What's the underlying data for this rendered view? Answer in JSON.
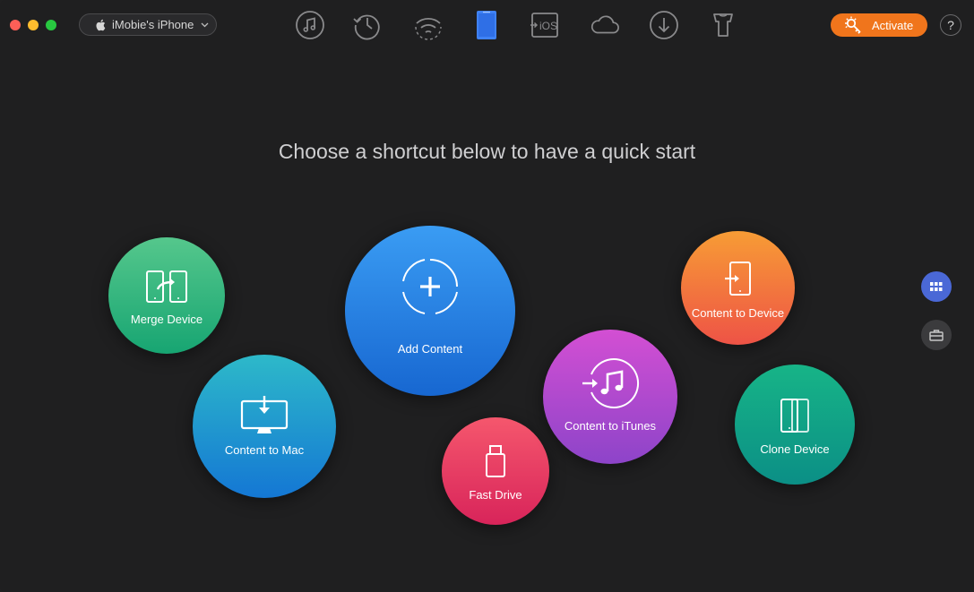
{
  "window": {
    "device_selector": {
      "label": "iMobie's iPhone",
      "icon": "apple-icon"
    }
  },
  "toolbar": {
    "tools": [
      {
        "name": "music-icon"
      },
      {
        "name": "history-icon"
      },
      {
        "name": "wifi-sync-icon"
      },
      {
        "name": "device-manager-icon"
      },
      {
        "name": "ios-mover-icon",
        "text": "iOS"
      },
      {
        "name": "icloud-icon"
      },
      {
        "name": "download-icon"
      },
      {
        "name": "ringtone-icon"
      }
    ],
    "active_tool": "device-manager-icon",
    "activate_label": "Activate",
    "help_label": "?"
  },
  "main": {
    "headline": "Choose a shortcut below to have a quick start",
    "shortcuts": [
      {
        "id": "merge-device",
        "label": "Merge Device",
        "color_top": "#55c78c",
        "color_bottom": "#17a572"
      },
      {
        "id": "content-to-mac",
        "label": "Content to Mac",
        "color_top": "#2db9c9",
        "color_bottom": "#1477d4"
      },
      {
        "id": "add-content",
        "label": "Add Content",
        "color_top": "#3a9cf3",
        "color_bottom": "#1767d1"
      },
      {
        "id": "fast-drive",
        "label": "Fast Drive",
        "color_top": "#f5576d",
        "color_bottom": "#d8245a"
      },
      {
        "id": "content-to-itunes",
        "label": "Content to iTunes",
        "color_top": "#d34fd3",
        "color_bottom": "#8d44c9"
      },
      {
        "id": "content-to-device",
        "label": "Content to Device",
        "color_top": "#f79c35",
        "color_bottom": "#ee5346"
      },
      {
        "id": "clone-device",
        "label": "Clone Device",
        "color_top": "#17b487",
        "color_bottom": "#0b8f86"
      }
    ]
  },
  "side_panel": {
    "buttons": [
      {
        "name": "grid-view-icon",
        "active": true,
        "color": "#4a68d6"
      },
      {
        "name": "toolbox-icon",
        "active": false,
        "color": "#3b3b3d"
      }
    ]
  },
  "colors": {
    "background": "#1f1f20",
    "accent_orange": "#f0751c",
    "active_tab_blue": "#3f82f5"
  }
}
